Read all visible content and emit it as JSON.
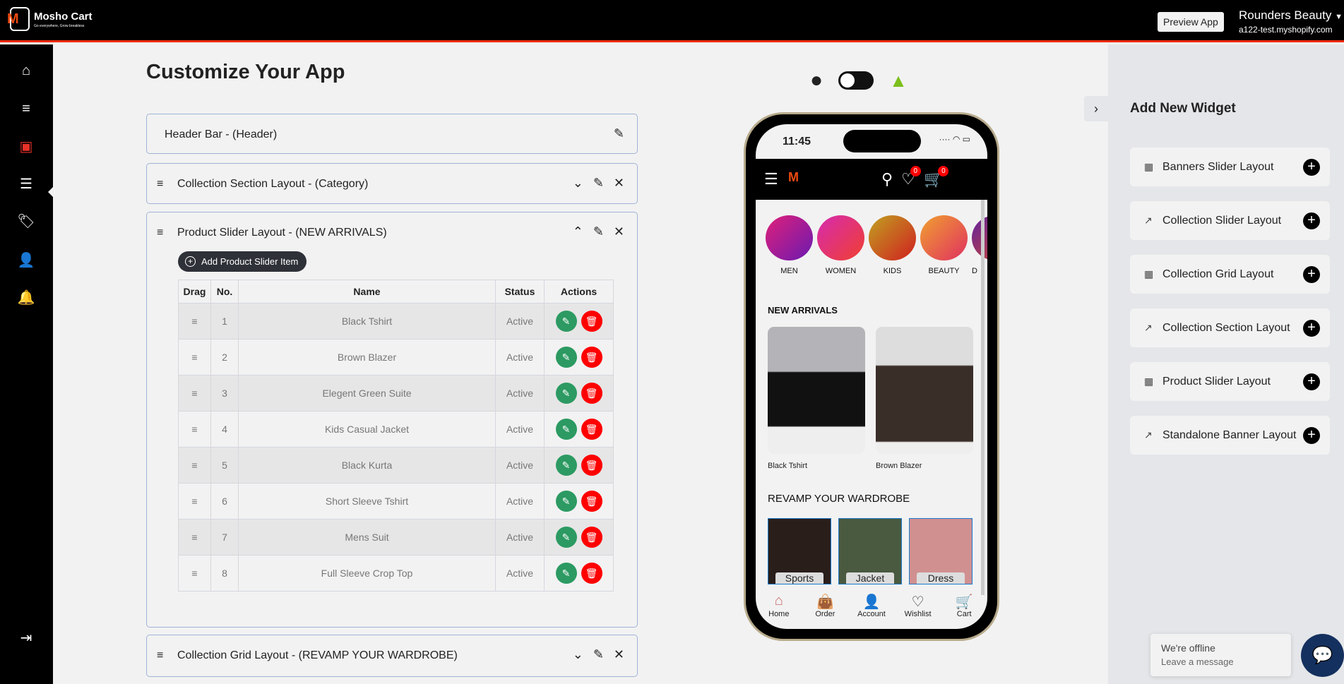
{
  "header": {
    "brand": "Mosho Cart",
    "tagline": "Go everywhere, Grow breakless",
    "preview_label": "Preview App",
    "store_name": "Rounders Beauty",
    "store_domain": "a122-test.myshopify.com"
  },
  "sidebar": {
    "items": [
      {
        "icon": "home-gear-icon"
      },
      {
        "icon": "menu-icon"
      },
      {
        "icon": "grid-icon",
        "active": true
      },
      {
        "icon": "list-icon"
      },
      {
        "icon": "tag-icon"
      },
      {
        "icon": "user-list-icon"
      },
      {
        "icon": "bell-icon"
      },
      {
        "icon": "logout-icon"
      }
    ]
  },
  "page": {
    "title": "Customize Your App"
  },
  "sections": [
    {
      "title": "Header Bar - (Header)"
    },
    {
      "title": "Collection Section Layout - (Category)"
    },
    {
      "title": "Product Slider Layout - (NEW ARRIVALS)",
      "add_label": "Add Product Slider Item",
      "columns": [
        "Drag",
        "No.",
        "Name",
        "Status",
        "Actions"
      ],
      "rows": [
        {
          "no": "1",
          "name": "Black Tshirt",
          "status": "Active"
        },
        {
          "no": "2",
          "name": "Brown Blazer",
          "status": "Active"
        },
        {
          "no": "3",
          "name": "Elegent Green Suite",
          "status": "Active"
        },
        {
          "no": "4",
          "name": "Kids Casual Jacket",
          "status": "Active"
        },
        {
          "no": "5",
          "name": "Black Kurta",
          "status": "Active"
        },
        {
          "no": "6",
          "name": "Short Sleeve Tshirt",
          "status": "Active"
        },
        {
          "no": "7",
          "name": "Mens Suit",
          "status": "Active"
        },
        {
          "no": "8",
          "name": "Full Sleeve Crop Top",
          "status": "Active"
        }
      ]
    },
    {
      "title": "Collection Grid Layout - (REVAMP YOUR WARDROBE)"
    }
  ],
  "preview": {
    "time": "11:45",
    "wishlist_count": "0",
    "cart_count": "0",
    "categories": [
      "MEN",
      "WOMEN",
      "KIDS",
      "BEAUTY",
      "D"
    ],
    "new_arrivals_title": "NEW ARRIVALS",
    "products": [
      "Black Tshirt",
      "Brown Blazer"
    ],
    "grid_title": "REVAMP YOUR WARDROBE",
    "grid_items": [
      "Sports",
      "Jacket",
      "Dress"
    ],
    "nav": [
      "Home",
      "Order",
      "Account",
      "Wishlist",
      "Cart"
    ]
  },
  "widgets": {
    "title": "Add New Widget",
    "items": [
      "Banners Slider Layout",
      "Collection Slider Layout",
      "Collection Grid Layout",
      "Collection Section Layout",
      "Product Slider Layout",
      "Standalone Banner Layout"
    ]
  },
  "chat": {
    "status": "We're offline",
    "prompt": "Leave a message"
  },
  "colors": {
    "accent": "#f02a0c",
    "edit": "#2c9a62",
    "delete": "#ff0000",
    "chat": "#14305e"
  }
}
